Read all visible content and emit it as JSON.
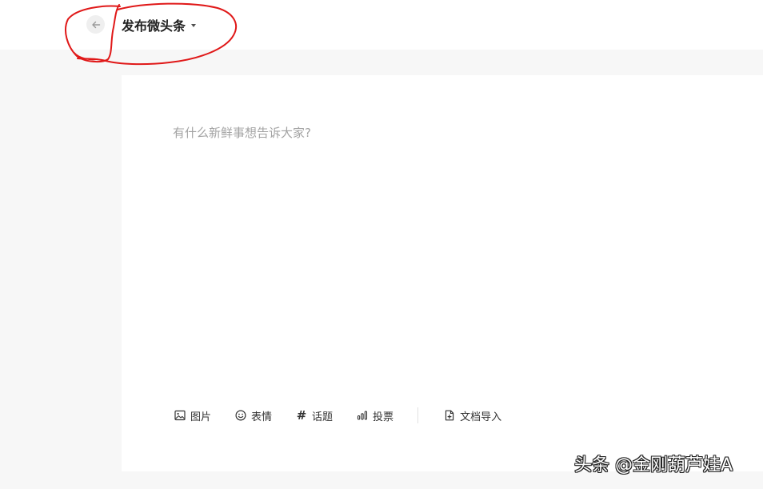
{
  "header": {
    "title": "发布微头条"
  },
  "composer": {
    "placeholder": "有什么新鲜事想告诉大家?"
  },
  "toolbar": {
    "items": [
      {
        "label": "图片",
        "icon": "image-icon"
      },
      {
        "label": "表情",
        "icon": "smiley-icon"
      },
      {
        "label": "话题",
        "icon": "hash-icon"
      },
      {
        "label": "投票",
        "icon": "bar-chart-icon"
      },
      {
        "label": "文档导入",
        "icon": "document-import-icon"
      }
    ]
  },
  "watermark": {
    "text": "头条 @金刚葫芦娃A"
  },
  "colors": {
    "annotation": "#e01818",
    "page_background": "#f7f7f7",
    "placeholder": "#a3a3a3"
  }
}
